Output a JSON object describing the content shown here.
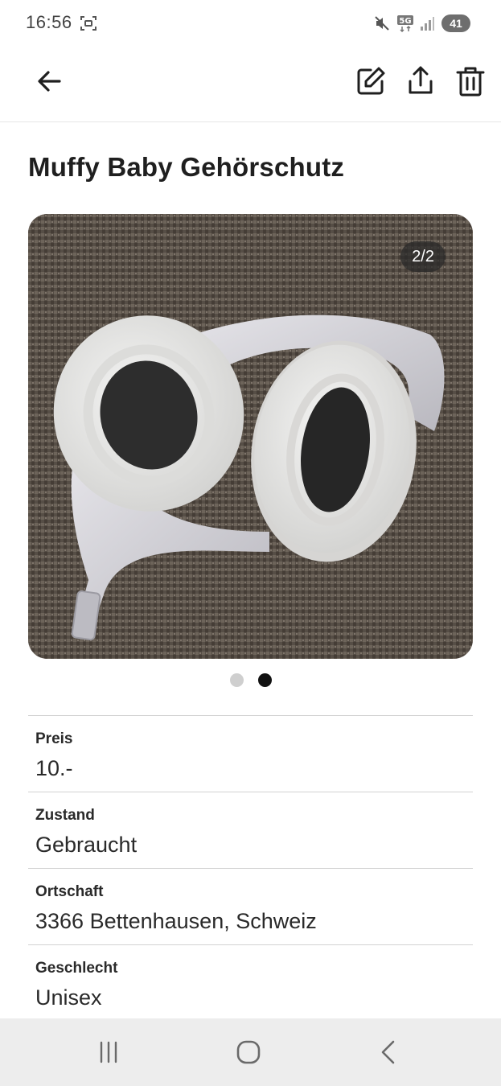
{
  "status_bar": {
    "time": "16:56",
    "network": "5G",
    "battery": "41",
    "icons": [
      "screenshot-icon",
      "mute-icon",
      "5g-icon",
      "signal-icon",
      "battery-icon"
    ]
  },
  "app_bar": {
    "icons": [
      "arrow-left-icon",
      "edit-icon",
      "share-icon",
      "trash-icon"
    ]
  },
  "listing": {
    "title": "Muffy Baby Gehörschutz",
    "image_counter": "2/2",
    "image_count": 2,
    "active_image": 2,
    "details": [
      {
        "label": "Preis",
        "value": "10.-"
      },
      {
        "label": "Zustand",
        "value": "Gebraucht"
      },
      {
        "label": "Ortschaft",
        "value": "3366 Bettenhausen, Schweiz"
      },
      {
        "label": "Geschlecht",
        "value": "Unisex"
      }
    ]
  },
  "nav_bar": {
    "icons": [
      "recents-icon",
      "home-icon",
      "back-icon"
    ]
  },
  "colors": {
    "text": "#1f1f1f",
    "divider": "#d2d2d2",
    "dot_active": "#111111",
    "dot_inactive": "#cfcfcf",
    "nav_bg": "#ededed"
  }
}
